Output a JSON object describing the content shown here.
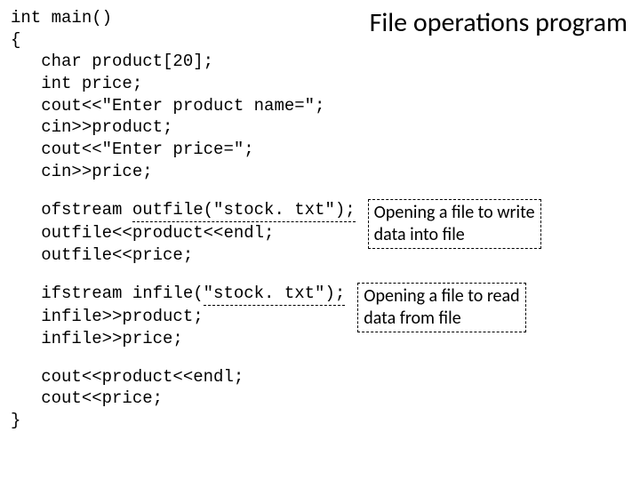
{
  "title": "File operations program",
  "code": {
    "line1": "int main()",
    "line2": "{",
    "block1": "   char product[20];\n   int price;\n   cout<<\"Enter product name=\";\n   cin>>product;\n   cout<<\"Enter price=\";\n   cin>>price;",
    "block2_pre": "   ofstream ",
    "block2_u": "outfile(\"stock. txt\");",
    "block2_rest": "\n   outfile<<product<<endl;\n   outfile<<price;",
    "block3_pre": "   ifstream infile(",
    "block3_u": "\"stock. txt\");",
    "block3_rest": "\n   infile>>product;\n   infile>>price;",
    "block4": "   cout<<product<<endl;\n   cout<<price;",
    "line_end": "}"
  },
  "annotations": {
    "write": "Opening a file to write\ndata into file",
    "read": "Opening a file to read\ndata from file"
  }
}
